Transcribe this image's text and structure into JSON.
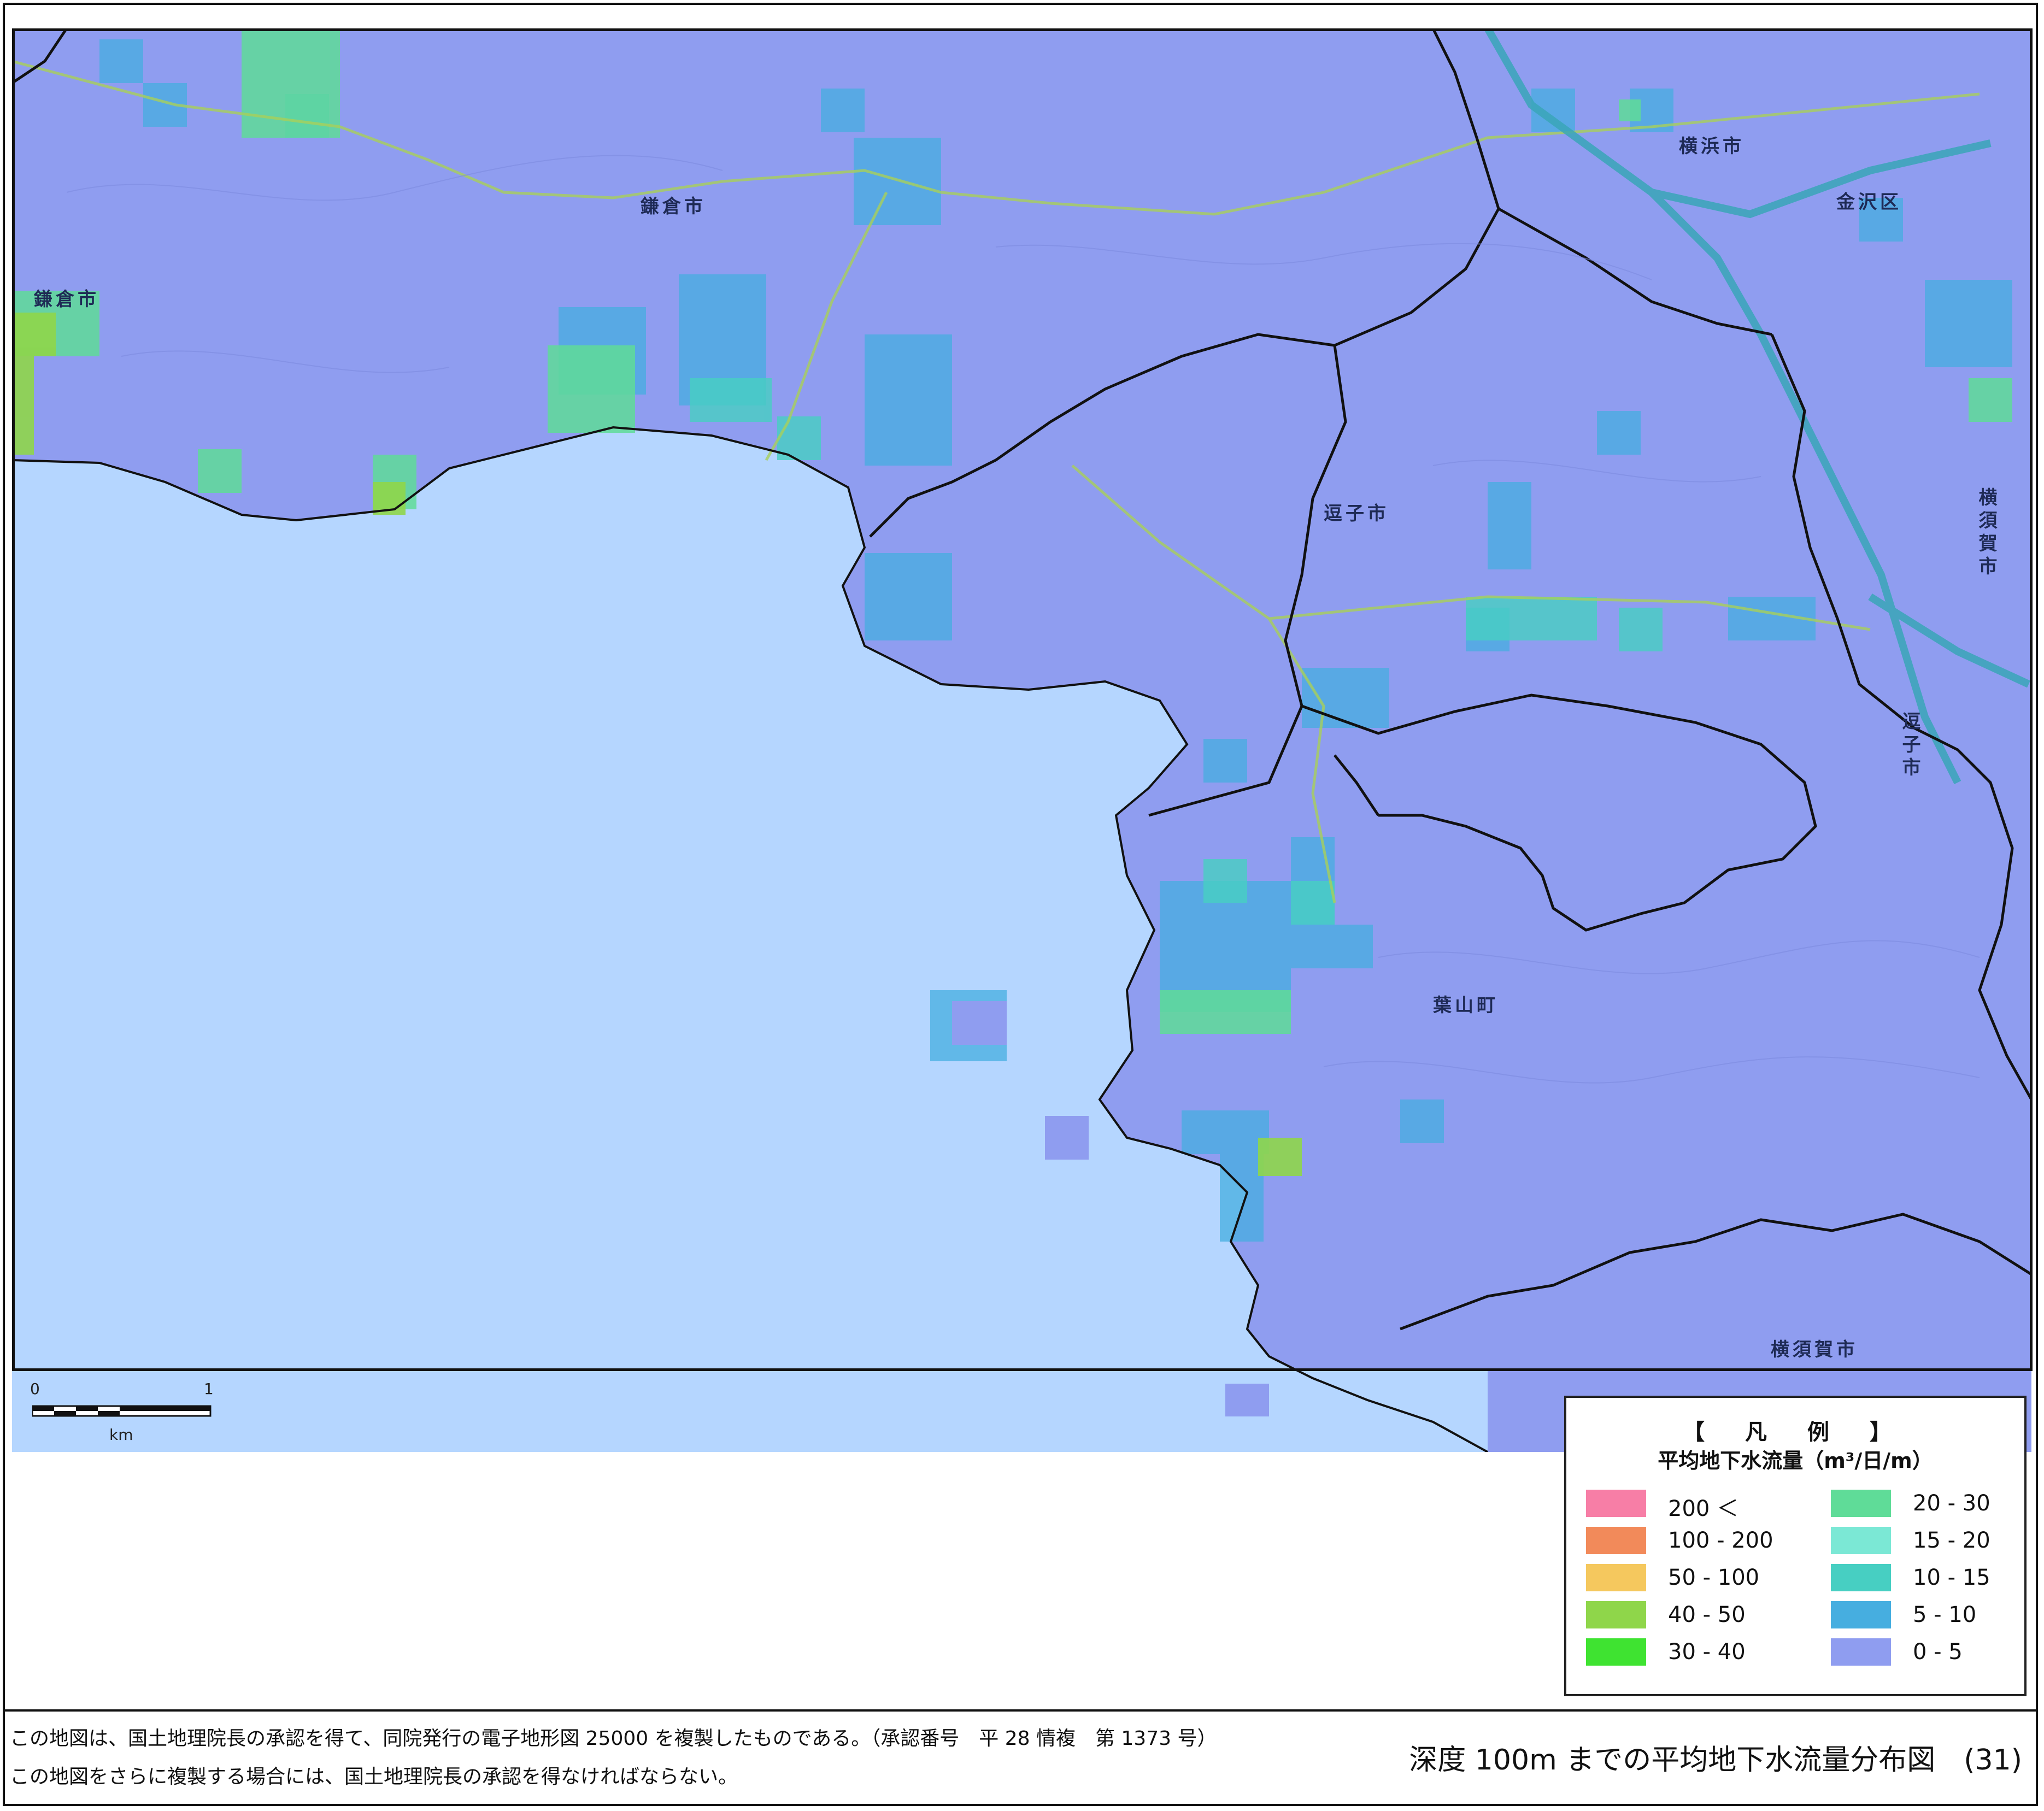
{
  "map": {
    "places": [
      {
        "id": "yokohama-shi",
        "label": "横浜市"
      },
      {
        "id": "kanazawa-ku",
        "label": "金沢区"
      },
      {
        "id": "kamakura-shi-top",
        "label": "鎌倉市"
      },
      {
        "id": "kamakura-shi-left",
        "label": "鎌倉市"
      },
      {
        "id": "zushi-shi",
        "label": "逗子市"
      },
      {
        "id": "zushi-shi-right",
        "label": "逗子市"
      },
      {
        "id": "yokosuka-shi-right",
        "label": "横須賀市"
      },
      {
        "id": "hayama-machi",
        "label": "葉山町"
      },
      {
        "id": "yokosuka-shi-bottom",
        "label": "横須賀市"
      }
    ],
    "scale": {
      "start": "0",
      "end": "1",
      "unit": "km"
    }
  },
  "legend": {
    "title": "【 凡 例 】",
    "subtitle": "平均地下水流量（m³/日/m）",
    "items": [
      {
        "range": "200 ＜",
        "color": "#f77ea6"
      },
      {
        "range": "100 - 200",
        "color": "#f28a5a"
      },
      {
        "range": "50 - 100",
        "color": "#f5c85e"
      },
      {
        "range": "40 - 50",
        "color": "#8fd64a"
      },
      {
        "range": "30 - 40",
        "color": "#3fe331"
      },
      {
        "range": "20 - 30",
        "color": "#5fdc98"
      },
      {
        "range": "15 - 20",
        "color": "#7be8d5"
      },
      {
        "range": "10 - 15",
        "color": "#47cfc2"
      },
      {
        "range": "5 - 10",
        "color": "#46aee0"
      },
      {
        "range": "0 - 5",
        "color": "#8f9df0"
      }
    ]
  },
  "colors": {
    "sea": "#b5d6ff",
    "land": "#8f9df0",
    "boundary": "#111111"
  },
  "footer": {
    "credit_line1": "この地図は、国土地理院長の承認を得て、同院発行の電子地形図 25000 を複製したものである。（承認番号　平 28 情複　第 1373 号）",
    "credit_line2": "この地図をさらに複製する場合には、国土地理院長の承認を得なければならない。",
    "caption": "深度 100m までの平均地下水流量分布図　(31)"
  }
}
